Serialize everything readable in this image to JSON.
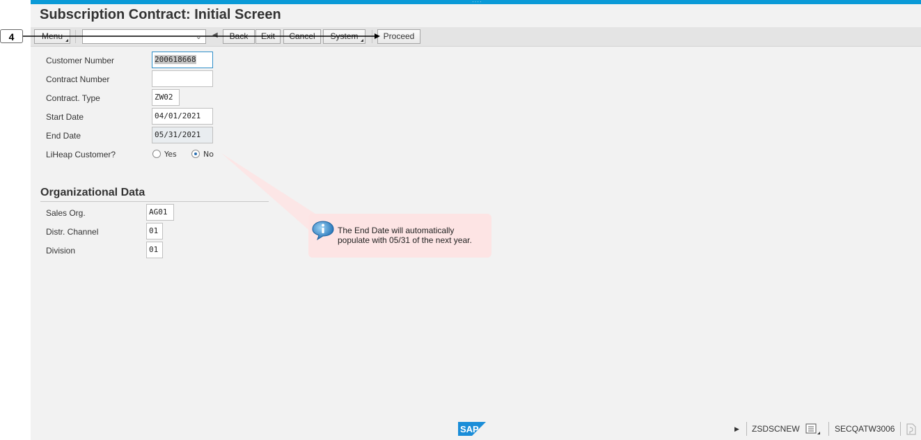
{
  "app": {
    "title": "Subscription Contract: Initial Screen"
  },
  "toolbar": {
    "menu_label": "Menu",
    "command_value": "",
    "back_label": "Back",
    "exit_label": "Exit",
    "cancel_label": "Cancel",
    "system_label": "System",
    "proceed_label": "Proceed"
  },
  "form": {
    "customer_number_label": "Customer Number",
    "customer_number_value": "200618668",
    "contract_number_label": "Contract Number",
    "contract_number_value": "",
    "contract_type_label": "Contract. Type",
    "contract_type_value": "ZW02",
    "start_date_label": "Start Date",
    "start_date_value": "04/01/2021",
    "end_date_label": "End Date",
    "end_date_value": "05/31/2021",
    "liheap_label": "LiHeap Customer?",
    "liheap_yes_label": "Yes",
    "liheap_no_label": "No",
    "liheap_selected": "No"
  },
  "org": {
    "section_title": "Organizational Data",
    "sales_org_label": "Sales Org.",
    "sales_org_value": "AG01",
    "distr_channel_label": "Distr. Channel",
    "distr_channel_value": "01",
    "division_label": "Division",
    "division_value": "01"
  },
  "annotation": {
    "step_number": "4",
    "callout_text": "The End Date will automatically populate with 05/31 of the next year."
  },
  "statusbar": {
    "transaction": "ZSDSCNEW",
    "system": "SECQATW3006"
  },
  "colors": {
    "accent": "#0a9ad7",
    "callout_bg": "#fde4e4",
    "sap_logo": "#1a8dd8"
  }
}
